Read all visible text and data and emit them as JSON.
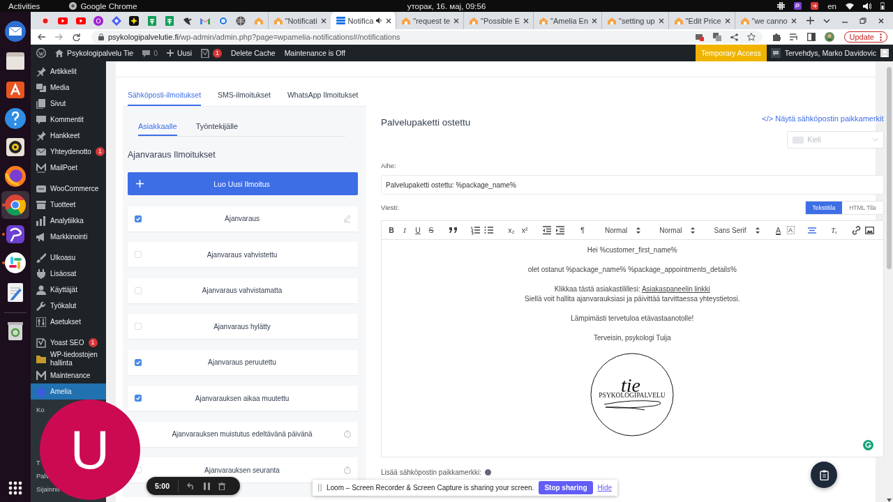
{
  "os_bar": {
    "activities": "Activities",
    "app": "Google Chrome",
    "clock": "уторак, 16. мај, 09:56",
    "language": "en"
  },
  "dock": {
    "apps": [
      {
        "selected": false,
        "running": false
      },
      {
        "selected": false,
        "running": false
      },
      {
        "selected": false,
        "running": false
      },
      {
        "selected": false,
        "running": false
      },
      {
        "selected": false,
        "running": false
      },
      {
        "selected": false,
        "running": false
      },
      {
        "selected": true,
        "running": true
      },
      {
        "selected": false,
        "running": true
      },
      {
        "selected": false,
        "running": true
      },
      {
        "selected": false,
        "running": false
      },
      {
        "selected": false,
        "running": false
      }
    ]
  },
  "browser": {
    "tabs": [
      {
        "title": "\"Notificati",
        "selected": false
      },
      {
        "title": "Notifica",
        "selected": true
      },
      {
        "title": "\"request te",
        "selected": false
      },
      {
        "title": "\"Possible E",
        "selected": false
      },
      {
        "title": "\"Amelia En",
        "selected": false
      },
      {
        "title": "\"setting up",
        "selected": false
      },
      {
        "title": "\"Edit Price",
        "selected": false
      },
      {
        "title": "\"we canno",
        "selected": false
      }
    ],
    "url_host": "psykologipalvelutie.fi",
    "url_path": "/wp-admin/admin.php?page=wpamelia-notifications#/notifications",
    "update_button": "Update"
  },
  "admin_bar": {
    "site": "Psykologipalvelu Tie",
    "comments": "0",
    "new": "Uusi",
    "yoast_badge": "1",
    "links": [
      "Delete Cache",
      "Maintenance is Off"
    ],
    "temporary_access": "Temporary Access",
    "greeting": "Tervehdys, Marko Davidovic"
  },
  "sidebar": {
    "groups": [
      [
        {
          "label": "Artikkelit",
          "selected": false
        },
        {
          "label": "Media",
          "selected": false
        },
        {
          "label": "Sivut",
          "selected": false
        },
        {
          "label": "Kommentit",
          "selected": false
        },
        {
          "label": "Hankkeet",
          "selected": false
        },
        {
          "label": "Yhteydenotto",
          "badge": "1",
          "selected": false
        },
        {
          "label": "MailPoet",
          "selected": false
        }
      ],
      [
        {
          "label": "WooCommerce",
          "selected": false
        },
        {
          "label": "Tuotteet",
          "selected": false
        },
        {
          "label": "Analytiikka",
          "selected": false
        },
        {
          "label": "Markkinointi",
          "selected": false
        }
      ],
      [
        {
          "label": "Ulkoasu",
          "selected": false
        },
        {
          "label": "Lisäosat",
          "selected": false
        },
        {
          "label": "Käyttäjät",
          "selected": false
        },
        {
          "label": "Työkalut",
          "selected": false
        },
        {
          "label": "Asetukset",
          "selected": false
        }
      ],
      [
        {
          "label": "Yoast SEO",
          "badge": "1",
          "selected": false
        },
        {
          "label": "WP-tiedostojen hallinta",
          "selected": false
        },
        {
          "label": "Maintenance",
          "selected": false
        },
        {
          "label": "Amelia",
          "selected": true
        }
      ]
    ],
    "submenu_top": [
      "Ko"
    ],
    "submenu_bottom": [
      "T",
      "Palv",
      "Sijainnit"
    ]
  },
  "notifications": {
    "channel_tabs": [
      {
        "label": "Sähköposti-ilmoitukset",
        "selected": true
      },
      {
        "label": "SMS-ilmoitukset",
        "selected": false
      },
      {
        "label": "WhatsApp Ilmoitukset",
        "selected": false
      }
    ],
    "audience_tabs": [
      {
        "label": "Asiakkaalle",
        "selected": true
      },
      {
        "label": "Työntekijälle",
        "selected": false
      }
    ],
    "heading": "Ajanvaraus Ilmoitukset",
    "create_button": "Luo Uusi Ilmoitus",
    "items": [
      {
        "label": "Ajanvaraus",
        "checked": true,
        "kind": "editable"
      },
      {
        "label": "Ajanvaraus vahvistettu",
        "checked": false,
        "kind": "plain"
      },
      {
        "label": "Ajanvaraus vahvistamatta",
        "checked": false,
        "kind": "plain"
      },
      {
        "label": "Ajanvaraus hylätty",
        "checked": false,
        "kind": "plain"
      },
      {
        "label": "Ajanvaraus peruutettu",
        "checked": true,
        "kind": "plain"
      },
      {
        "label": "Ajanvarauksen aikaa muutettu",
        "checked": true,
        "kind": "plain"
      },
      {
        "label": "Ajanvarauksen muistutus edeltävänä päivänä",
        "kind": "scheduled"
      },
      {
        "label": "Ajanvarauksen seuranta",
        "checked": false,
        "kind": "scheduled"
      }
    ]
  },
  "editor": {
    "title": "Palvelupaketti ostettu",
    "placeholders_link": "</> Näytä sähköpostin paikkamerkit",
    "language_placeholder": "Kieli",
    "subject_label": "Aihe:",
    "subject": "Palvelupaketti ostettu: %package_name%",
    "message_label": "Viesti:",
    "modes": [
      {
        "label": "Tekstitila",
        "selected": true
      },
      {
        "label": "HTML Tila",
        "selected": false
      }
    ],
    "toolbar": [
      {
        "kind": "bold",
        "label": "B"
      },
      {
        "kind": "italic",
        "label": "I"
      },
      {
        "kind": "underline",
        "label": "U"
      },
      {
        "kind": "strike",
        "label": "S"
      },
      {
        "kind": "quote"
      },
      {
        "kind": "ordered-list"
      },
      {
        "kind": "bullet-list"
      },
      {
        "kind": "subscript",
        "label": "x₂"
      },
      {
        "kind": "superscript",
        "label": "x²"
      },
      {
        "kind": "outdent"
      },
      {
        "kind": "indent"
      },
      {
        "kind": "direction",
        "label": "¶"
      },
      {
        "kind": "select",
        "label": "Normal"
      },
      {
        "kind": "select",
        "label": "Normal"
      },
      {
        "kind": "select",
        "label": "Sans Serif"
      },
      {
        "kind": "color",
        "label": "A"
      },
      {
        "kind": "background",
        "label": "A"
      },
      {
        "kind": "align"
      },
      {
        "kind": "clean",
        "label": "Tₓ"
      },
      {
        "kind": "link"
      },
      {
        "kind": "image"
      }
    ],
    "body": [
      {
        "lines": [
          {
            "text": "Hei %customer_first_name%"
          }
        ]
      },
      {
        "lines": [
          {
            "text": "olet ostanut %package_name% %package_appointments_details%"
          }
        ]
      },
      {
        "lines": [
          {
            "text": "Klikkaa tästä asiakastilillesi: ",
            "link": "Asiakaspaneelin linkki"
          },
          {
            "text": "Siellä voit hallita ajanvarauksiasi ja päivittää tarvittaessa yhteystietosi."
          }
        ]
      },
      {
        "lines": [
          {
            "text": "Lämpimästi tervetuloa etävastaanotolle!"
          }
        ]
      },
      {
        "lines": [
          {
            "text": "Terveisin, psykologi Tuija"
          }
        ]
      }
    ],
    "logo": {
      "script": "tie",
      "wordmark": "PSYKOLOGIPALVELU"
    },
    "placeholder_label": "Lisää sähköpostin paikkamerkki:"
  },
  "loom": {
    "camera_initial": "U",
    "timer": "5:00",
    "banner": "Loom – Screen Recorder & Screen Capture is sharing your screen.",
    "stop_button": "Stop sharing",
    "hide_link": "Hide"
  }
}
